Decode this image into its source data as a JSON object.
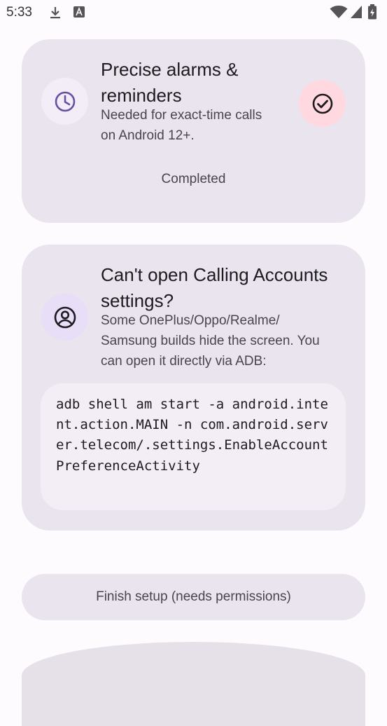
{
  "status_bar": {
    "time": "5:33",
    "icons": [
      "download-icon",
      "font-icon",
      "wifi-icon",
      "signal-icon",
      "battery-icon"
    ]
  },
  "cards": {
    "alarms": {
      "icon": "clock-icon",
      "title_line1": "Precise alarms &",
      "title_line2": "reminders",
      "desc_line1": "Needed for exact-time calls",
      "desc_line2": "on Android 12+.",
      "status_icon": "check-circle-icon",
      "status_label": "Completed"
    },
    "calling_accounts": {
      "icon": "account-circle-icon",
      "title_line1": "Can't open Calling Accounts",
      "title_line2": "settings?",
      "desc_line1": "Some OnePlus/Oppo/Realme/",
      "desc_line2": "Samsung builds hide the screen. You",
      "desc_line3": "can open it directly via ADB:",
      "code": "adb shell am start -a android.intent.action.MAIN -n com.android.server.telecom/.settings.EnableAccountPreferenceActivity"
    }
  },
  "finish_button": {
    "label": "Finish setup (needs permissions)"
  },
  "colors": {
    "card_bg": "#e9e4ee",
    "icon_circle_bg": "#f3edf7",
    "icon_accent": "#6750a4",
    "status_chip_bg": "#ffd9df"
  }
}
